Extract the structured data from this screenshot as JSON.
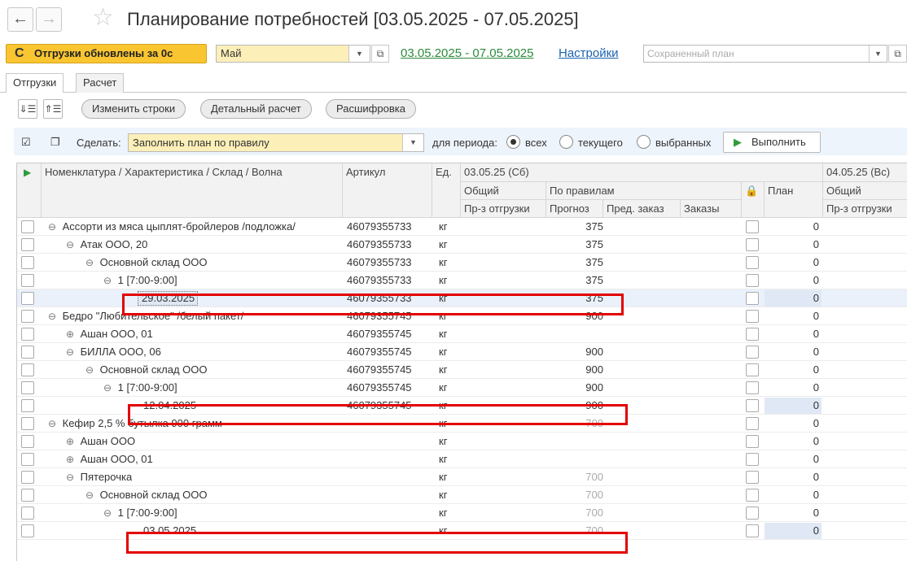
{
  "header": {
    "back_icon": "←",
    "forward_icon": "→",
    "title": "Планирование потребностей [03.05.2025 - 07.05.2025]"
  },
  "toolbar": {
    "refresh_label": "Отгрузки обновлены за 0с",
    "month_value": "Май",
    "period_link": "03.05.2025 - 07.05.2025",
    "settings_link": "Настройки",
    "saved_plan_placeholder": "Сохраненный план"
  },
  "tabs": [
    {
      "label": "Отгрузки",
      "active": true
    },
    {
      "label": "Расчет",
      "active": false
    }
  ],
  "actions": {
    "change_rows": "Изменить строки",
    "detailed_calc": "Детальный расчет",
    "breakdown": "Расшифровка"
  },
  "fill_bar": {
    "do_label": "Сделать:",
    "do_value": "Заполнить план по правилу",
    "period_label": "для периода:",
    "radio_all": "всех",
    "radio_current": "текущего",
    "radio_selected": "выбранных",
    "selected_radio": "всех",
    "execute_label": "Выполнить"
  },
  "table": {
    "headers": {
      "nomenclature": "Номенклатура / Характеристика / Склад / Волна",
      "article": "Артикул",
      "unit": "Ед.",
      "date1": "03.05.25 (Сб)",
      "total": "Общий",
      "by_rules": "По правилам",
      "plan": "План",
      "date2": "04.05.25 (Вс)",
      "total2": "Общий",
      "shipping": "Пр-з отгрузки",
      "forecast": "Прогноз",
      "prev_order": "Пред. заказ",
      "orders": "Заказы",
      "shipping2": "Пр-з отгрузки"
    },
    "rows": [
      {
        "name": "Ассорти из мяса цыплят-бройлеров /подложка/",
        "toggle": "⊖",
        "article": "46079355733",
        "unit": "кг",
        "forecast": "375",
        "plan": "0"
      },
      {
        "name": "Атак ООО, 20",
        "toggle": "⊖",
        "article": "46079355733",
        "unit": "кг",
        "forecast": "375",
        "plan": "0"
      },
      {
        "name": "Основной склад ООО",
        "toggle": "⊖",
        "article": "46079355733",
        "unit": "кг",
        "forecast": "375",
        "plan": "0"
      },
      {
        "name": "1 [7:00-9:00]",
        "toggle": "⊖",
        "article": "46079355733",
        "unit": "кг",
        "forecast": "375",
        "plan": "0"
      },
      {
        "name": "29.03.2025",
        "toggle": "",
        "article": "46079355733",
        "unit": "кг",
        "forecast": "375",
        "plan": "0"
      },
      {
        "name": "Бедро \"Любительское\" /белый пакет/",
        "toggle": "⊖",
        "article": "46079355745",
        "unit": "кг",
        "forecast": "900",
        "plan": "0"
      },
      {
        "name": "Ашан ООО, 01",
        "toggle": "⊕",
        "article": "46079355745",
        "unit": "кг",
        "forecast": "",
        "plan": "0"
      },
      {
        "name": "БИЛЛА ООО, 06",
        "toggle": "⊖",
        "article": "46079355745",
        "unit": "кг",
        "forecast": "900",
        "plan": "0"
      },
      {
        "name": "Основной склад ООО",
        "toggle": "⊖",
        "article": "46079355745",
        "unit": "кг",
        "forecast": "900",
        "plan": "0"
      },
      {
        "name": "1 [7:00-9:00]",
        "toggle": "⊖",
        "article": "46079355745",
        "unit": "кг",
        "forecast": "900",
        "plan": "0"
      },
      {
        "name": "12.04.2025",
        "toggle": "",
        "article": "46079355745",
        "unit": "кг",
        "forecast": "900",
        "plan": "0"
      },
      {
        "name": "Кефир 2,5 % бутылка 900 грамм",
        "toggle": "⊖",
        "article": "",
        "unit": "кг",
        "forecast": "700",
        "plan": "0"
      },
      {
        "name": "Ашан ООО",
        "toggle": "⊕",
        "article": "",
        "unit": "кг",
        "forecast": "",
        "plan": "0"
      },
      {
        "name": "Ашан ООО, 01",
        "toggle": "⊕",
        "article": "",
        "unit": "кг",
        "forecast": "",
        "plan": "0"
      },
      {
        "name": "Пятерочка",
        "toggle": "⊖",
        "article": "",
        "unit": "кг",
        "forecast": "700",
        "plan": "0"
      },
      {
        "name": "Основной склад ООО",
        "toggle": "⊖",
        "article": "",
        "unit": "кг",
        "forecast": "700",
        "plan": "0"
      },
      {
        "name": "1 [7:00-9:00]",
        "toggle": "⊖",
        "article": "",
        "unit": "кг",
        "forecast": "700",
        "plan": "0"
      },
      {
        "name": "03.05.2025",
        "toggle": "",
        "article": "",
        "unit": "кг",
        "forecast": "700",
        "plan": "0"
      }
    ]
  },
  "colors": {
    "refresh_button": "#f9c531",
    "select_bg": "#fdefb8",
    "period_link": "#2c8a3b",
    "settings_link": "#1c62b0",
    "highlight_border": "#e30000",
    "selected_row": "#eaf1fb"
  },
  "icons": {
    "star": "star-icon",
    "refresh": "refresh-icon",
    "execute": "play-icon",
    "lock": "lock-icon"
  }
}
